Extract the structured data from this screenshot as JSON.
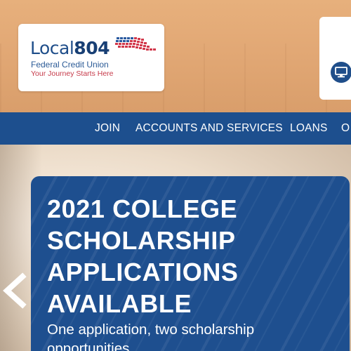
{
  "header": {
    "logo": {
      "name_part1": "Local",
      "name_part2": "804",
      "subtitle": "Federal Credit Union",
      "tagline": "Your Journey Starts Here"
    },
    "login_icon": "monitor-icon"
  },
  "nav": {
    "items": [
      {
        "label": "JOIN"
      },
      {
        "label": "ACCOUNTS AND SERVICES"
      },
      {
        "label": "LOANS"
      },
      {
        "label": "O"
      }
    ]
  },
  "hero": {
    "prev_icon": "chevron-left-icon",
    "promo": {
      "title": "2021 COLLEGE\nSCHOLARSHIP\nAPPLICATIONS\nAVAILABLE",
      "subtitle": "One application, two scholarship\nopportunities"
    }
  },
  "colors": {
    "brand_blue": "#1d4f8e",
    "accent_red": "#c63a4a",
    "header_tan": "#e2a875"
  }
}
